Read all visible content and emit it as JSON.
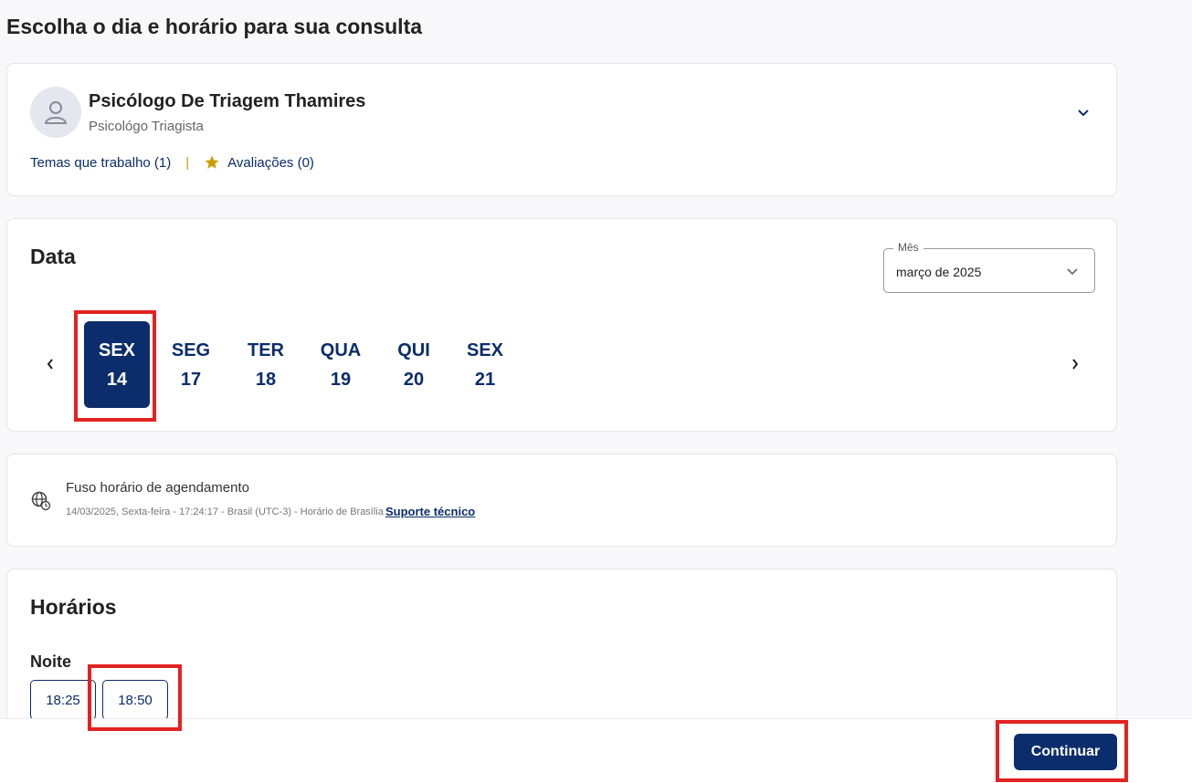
{
  "page": {
    "title": "Escolha o dia e horário para sua consulta"
  },
  "professional": {
    "name": "Psicólogo De Triagem Thamires",
    "role": "Psicológo Triagista",
    "themes_link": "Temas que trabalho (1)",
    "separator": "|",
    "reviews_link": "Avaliações (0)"
  },
  "date_section": {
    "title": "Data",
    "month_label": "Mês",
    "month_value": "março de 2025",
    "days": [
      {
        "weekday": "SEX",
        "day": "14",
        "selected": true
      },
      {
        "weekday": "SEG",
        "day": "17",
        "selected": false
      },
      {
        "weekday": "TER",
        "day": "18",
        "selected": false
      },
      {
        "weekday": "QUA",
        "day": "19",
        "selected": false
      },
      {
        "weekday": "QUI",
        "day": "20",
        "selected": false
      },
      {
        "weekday": "SEX",
        "day": "21",
        "selected": false
      }
    ]
  },
  "timezone": {
    "title": "Fuso horário de agendamento",
    "detail": "14/03/2025, Sexta-feira - 17:24:17 - Brasil (UTC-3) - Horário de Brasília",
    "support_link": "Suporte técnico"
  },
  "hours": {
    "title": "Horários",
    "period": "Noite",
    "slots": [
      "18:25",
      "18:50"
    ]
  },
  "footer": {
    "continue_label": "Continuar"
  },
  "colors": {
    "primary": "#0b2d6b",
    "highlight": "#e32222",
    "star": "#c8a000"
  }
}
